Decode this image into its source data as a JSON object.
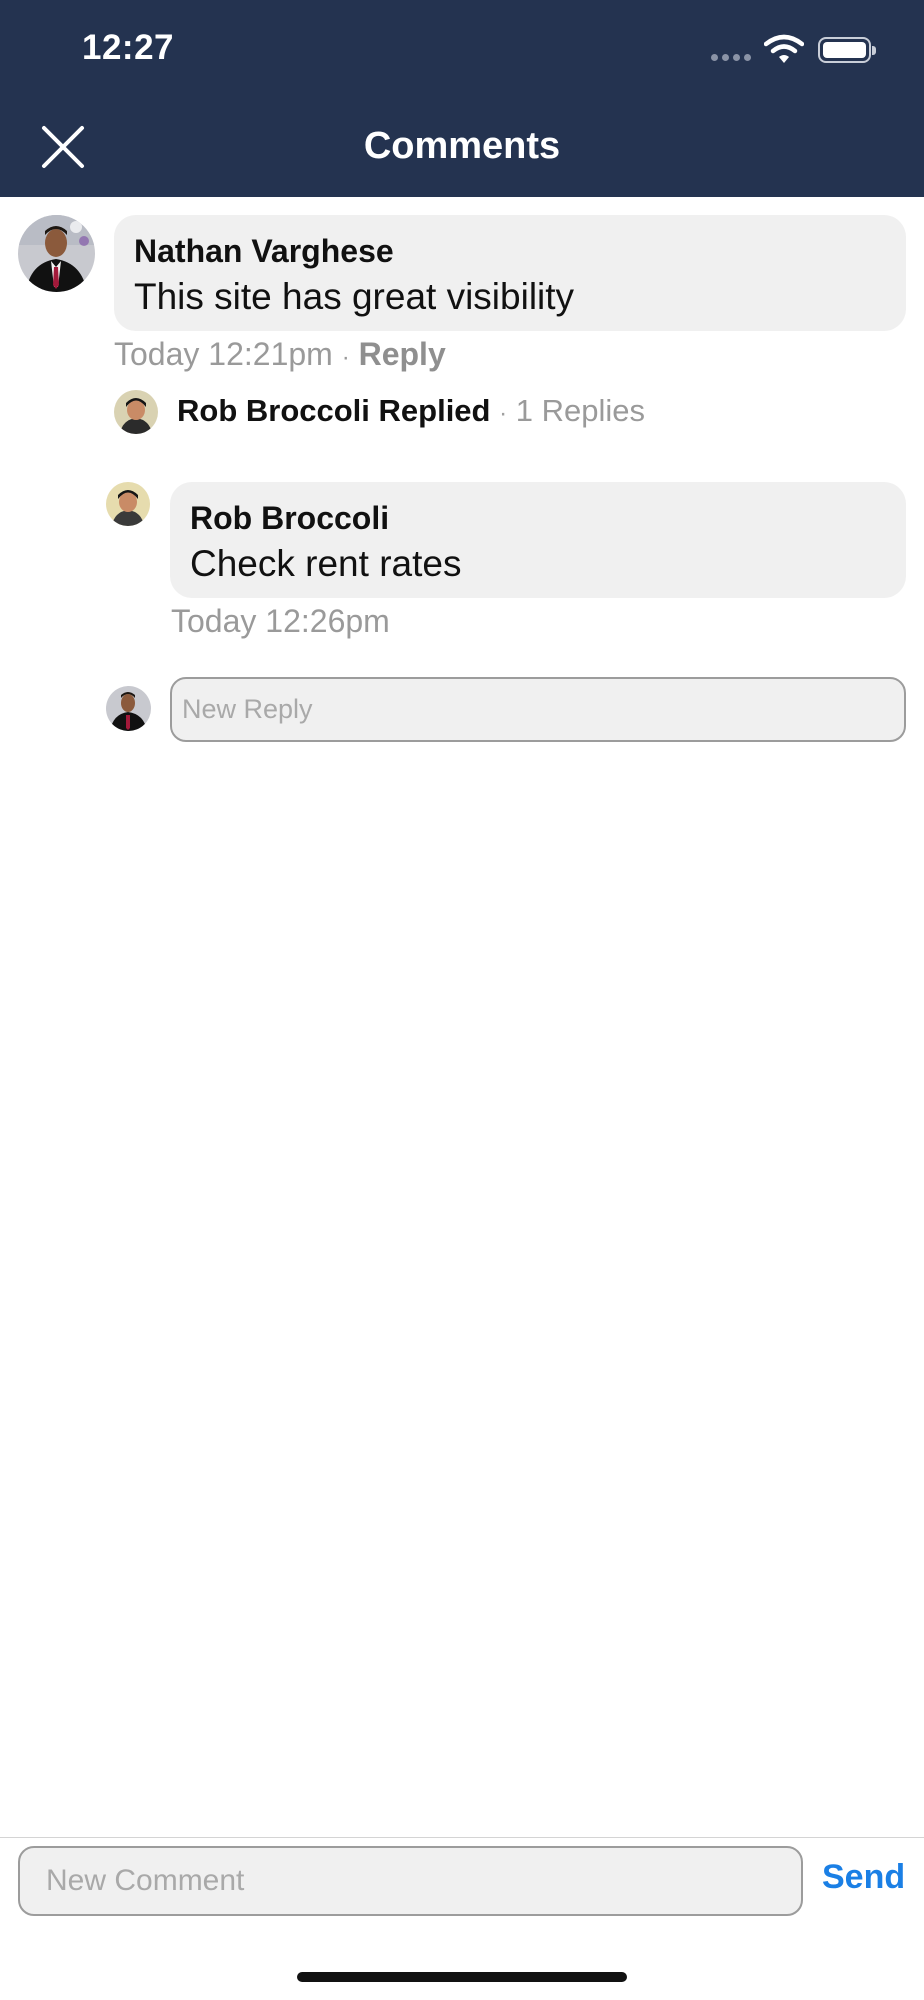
{
  "status_bar": {
    "time": "12:27"
  },
  "header": {
    "title": "Comments"
  },
  "comment": {
    "author": "Nathan Varghese",
    "text": "This site has great visibility",
    "timestamp": "Today 12:21pm",
    "separator": "·",
    "reply_label": "Reply",
    "replies_summary": {
      "label": "Rob Broccoli Replied",
      "separator": "·",
      "count_text": "1 Replies"
    }
  },
  "reply": {
    "author": "Rob Broccoli",
    "text": "Check rent rates",
    "timestamp": "Today 12:26pm"
  },
  "reply_input": {
    "placeholder": "New Reply"
  },
  "footer": {
    "comment_placeholder": "New Comment",
    "send_label": "Send"
  },
  "colors": {
    "header_bg": "#243350",
    "bubble_bg": "#f0f0f0",
    "accent": "#1a7fe5"
  }
}
